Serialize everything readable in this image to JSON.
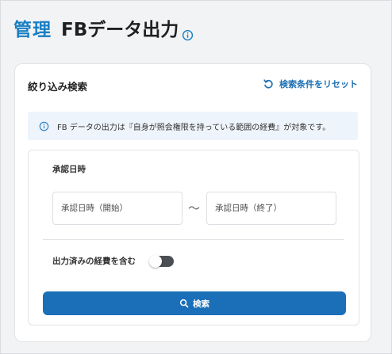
{
  "header": {
    "section": "管理",
    "title": "FBデータ出力",
    "info_icon": "info-circle-icon"
  },
  "filter": {
    "title": "絞り込み検索",
    "reset_label": "検索条件をリセット",
    "reset_icon": "rotate-ccw-icon",
    "notice": "FB データの出力は『自身が照会権限を持っている範囲の経費』が対象です。",
    "notice_icon": "info-circle-icon",
    "approval_date_label": "承認日時",
    "date_start_placeholder": "承認日時（開始）",
    "date_end_placeholder": "承認日時（終了）",
    "range_separator": "〜",
    "include_exported_label": "出力済みの経費を含む",
    "include_exported_on": false,
    "search_label": "検索",
    "search_icon": "search-icon"
  },
  "colors": {
    "accent": "#1a7fc4",
    "button": "#1b6fb8",
    "notice_bg": "#eef4fb",
    "toggle_off": "#4b4f55",
    "page_bg": "#f2f3f5"
  }
}
